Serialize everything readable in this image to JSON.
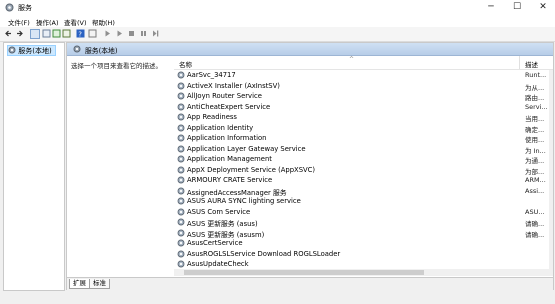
{
  "window": {
    "title": "服务",
    "min": "─",
    "max": "☐",
    "close": "✕"
  },
  "menu": [
    "文件(F)",
    "操作(A)",
    "查看(V)",
    "帮助(H)"
  ],
  "tree": {
    "root_label": "服务(本地)"
  },
  "pane": {
    "title": "服务(本地)",
    "description_prompt": "选择一个项目来查看它的描述。",
    "col_name": "名称",
    "col_desc": "描述"
  },
  "services": [
    {
      "name": "AarSvc_34717",
      "desc": "Runt..."
    },
    {
      "name": "ActiveX Installer (AxInstSV)",
      "desc": "为从..."
    },
    {
      "name": "AllJoyn Router Service",
      "desc": "路由..."
    },
    {
      "name": "AntiCheatExpert Service",
      "desc": "Servi..."
    },
    {
      "name": "App Readiness",
      "desc": "当用..."
    },
    {
      "name": "Application Identity",
      "desc": "确定..."
    },
    {
      "name": "Application Information",
      "desc": "使用..."
    },
    {
      "name": "Application Layer Gateway Service",
      "desc": "为 In..."
    },
    {
      "name": "Application Management",
      "desc": "为通..."
    },
    {
      "name": "AppX Deployment Service (AppXSVC)",
      "desc": "为部..."
    },
    {
      "name": "ARMOURY CRATE Service",
      "desc": "ARM..."
    },
    {
      "name": "AssignedAccessManager 服务",
      "desc": "Assi..."
    },
    {
      "name": "ASUS AURA SYNC lighting service",
      "desc": ""
    },
    {
      "name": "ASUS Com Service",
      "desc": "ASU..."
    },
    {
      "name": "ASUS 更新服务 (asus)",
      "desc": "请确..."
    },
    {
      "name": "ASUS 更新服务 (asusm)",
      "desc": "请确..."
    },
    {
      "name": "AsusCertService",
      "desc": ""
    },
    {
      "name": "AsusROGLSLService Download ROGLSLoader",
      "desc": ""
    },
    {
      "name": "AsusUpdateCheck",
      "desc": ""
    }
  ],
  "tabs": {
    "extended": "扩展",
    "standard": "标准"
  }
}
